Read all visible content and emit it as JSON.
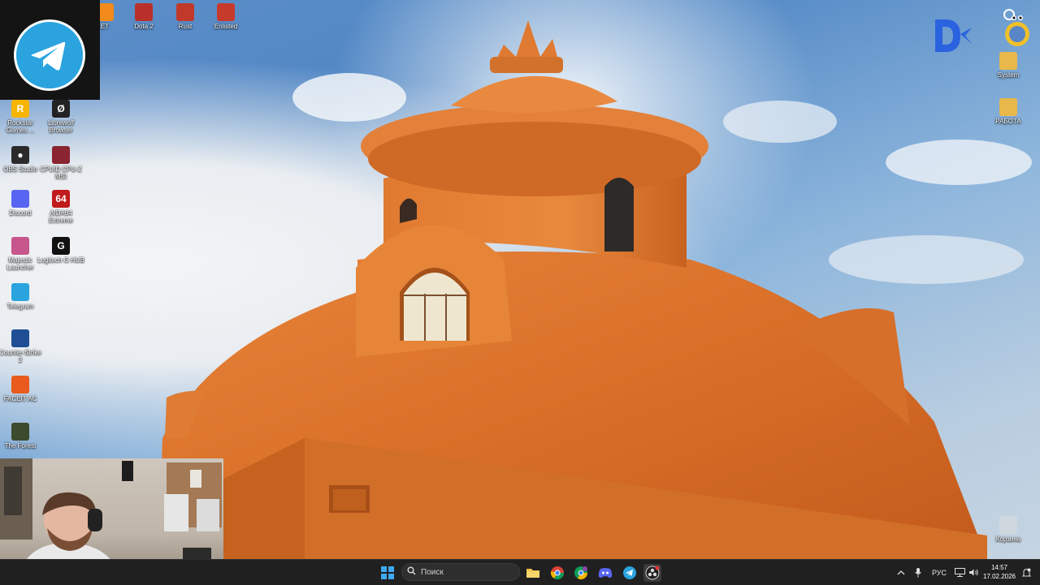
{
  "desktop_left": [
    {
      "label": "ET",
      "color": "#f28a1c",
      "glyph": ""
    },
    {
      "label": "Dota 2",
      "color": "#b9302a",
      "glyph": ""
    },
    {
      "label": "Rust",
      "color": "#c1392b",
      "glyph": ""
    },
    {
      "label": "Enlisted",
      "color": "#c63a2c",
      "glyph": ""
    },
    {
      "label": "Rockstar Games ...",
      "color": "#f7b500",
      "glyph": "R"
    },
    {
      "label": "Librewolf Browser",
      "color": "#222222",
      "glyph": "Ø"
    },
    {
      "label": "OBS Studio",
      "color": "#2b2b2b",
      "glyph": "●"
    },
    {
      "label": "CPUID CPU-Z MSI",
      "color": "#8a2430",
      "glyph": ""
    },
    {
      "label": "Discord",
      "color": "#5865f2",
      "glyph": ""
    },
    {
      "label": "AIDA64 Extreme",
      "color": "#c11b1b",
      "glyph": "64"
    },
    {
      "label": "Majestic Launcher",
      "color": "#c6568b",
      "glyph": ""
    },
    {
      "label": "Logitech G HUB",
      "color": "#111111",
      "glyph": "G"
    },
    {
      "label": "Telegram",
      "color": "#2aa3df",
      "glyph": ""
    },
    {
      "label": "Counter-Strike 2",
      "color": "#1f4e94",
      "glyph": ""
    },
    {
      "label": "FACEIT AC",
      "color": "#e85b1c",
      "glyph": ""
    },
    {
      "label": "The Forest",
      "color": "#3c4b2e",
      "glyph": ""
    }
  ],
  "desktop_right": [
    {
      "label": "System",
      "color": "#e8b84a"
    },
    {
      "label": "РАБОТА",
      "color": "#e8b84a"
    },
    {
      "label": "Корзина",
      "color": "#cfd8df"
    }
  ],
  "taskbar": {
    "search_placeholder": "Поиск",
    "language": "РУС",
    "time": "14:57",
    "date": "17.02.2026"
  }
}
